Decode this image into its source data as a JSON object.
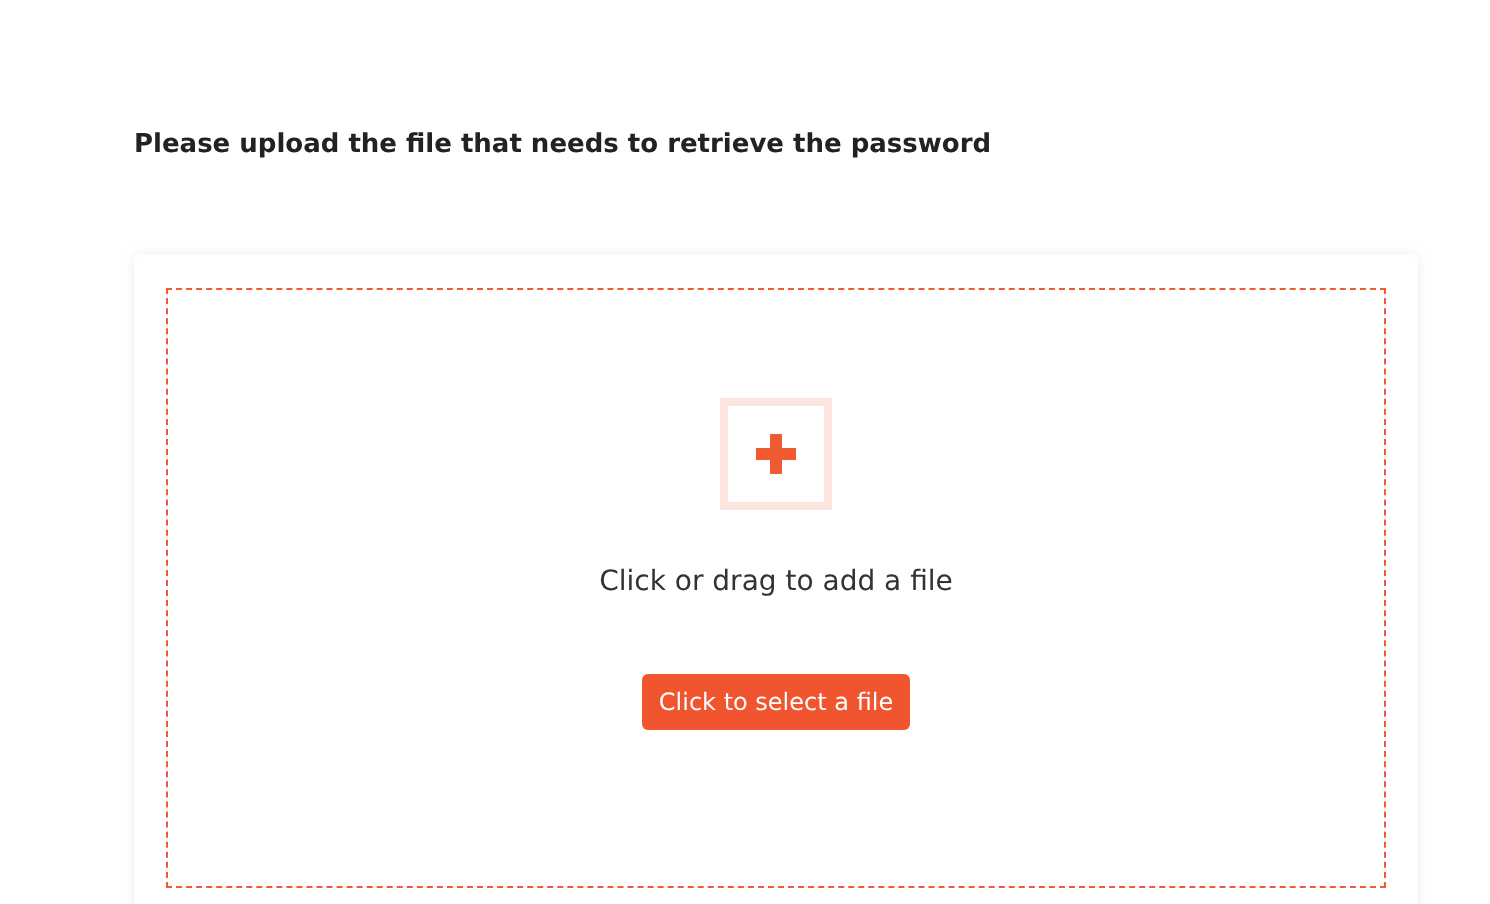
{
  "heading": "Please upload the file that needs to retrieve the password",
  "dropzone": {
    "hint": "Click or drag to add a file",
    "button": "Click to select a file"
  }
}
